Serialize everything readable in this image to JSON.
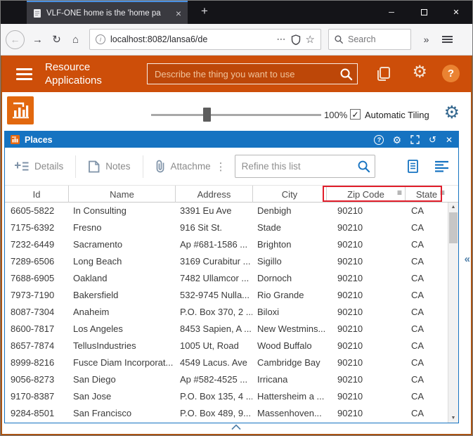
{
  "icons": {
    "minimize": "─",
    "close": "✕",
    "tab_close": "×",
    "new_tab": "+",
    "back": "←",
    "forward": "→",
    "reload": "↻",
    "home": "⌂",
    "info": "i",
    "page_actions": "⋯",
    "bookmark": "☆",
    "more_tools": "»",
    "overflow": "⋮",
    "filter": "≡",
    "gear": "⚙",
    "check": "✓",
    "help": "?",
    "history": "↺",
    "collapse": "«",
    "scroll_up": "▲",
    "scroll_down": "▼"
  },
  "browser": {
    "tab_title": "VLF-ONE home is the 'home pa",
    "url": "localhost:8082/lansa6/de",
    "search_placeholder": "Search"
  },
  "header": {
    "title_line1": "Resource",
    "title_line2": "Applications",
    "search_placeholder": "Describe the thing you want to use"
  },
  "workspace": {
    "zoom": "100%",
    "tiling_label": "Automatic Tiling",
    "checkbox_checked": true
  },
  "places": {
    "title": "Places",
    "toolbar": {
      "details": "Details",
      "notes": "Notes",
      "attachments": "Attachme",
      "refine_placeholder": "Refine this list"
    },
    "table": {
      "columns": [
        "Id",
        "Name",
        "Address",
        "City",
        "Zip Code",
        "State"
      ],
      "filter_columns": [
        4,
        5
      ],
      "rows": [
        [
          "6605-5822",
          "In Consulting",
          "3391 Eu Ave",
          "Denbigh",
          "90210",
          "CA"
        ],
        [
          "7175-6392",
          "Fresno",
          "916 Sit St.",
          "Stade",
          "90210",
          "CA"
        ],
        [
          "7232-6449",
          "Sacramento",
          "Ap #681-1586 ...",
          "Brighton",
          "90210",
          "CA"
        ],
        [
          "7289-6506",
          "Long Beach",
          "3169 Curabitur ...",
          "Sigillo",
          "90210",
          "CA"
        ],
        [
          "7688-6905",
          "Oakland",
          "7482 Ullamcor ...",
          "Dornoch",
          "90210",
          "CA"
        ],
        [
          "7973-7190",
          "Bakersfield",
          "532-9745 Nulla...",
          "Rio Grande",
          "90210",
          "CA"
        ],
        [
          "8087-7304",
          "Anaheim",
          "P.O. Box 370, 2 ...",
          "Biloxi",
          "90210",
          "CA"
        ],
        [
          "8600-7817",
          "Los Angeles",
          "8453 Sapien, A ...",
          "New Westmins...",
          "90210",
          "CA"
        ],
        [
          "8657-7874",
          "TellusIndustries",
          "1005 Ut, Road",
          "Wood Buffalo",
          "90210",
          "CA"
        ],
        [
          "8999-8216",
          "Fusce Diam Incorporat...",
          "4549 Lacus. Ave",
          "Cambridge Bay",
          "90210",
          "CA"
        ],
        [
          "9056-8273",
          "San Diego",
          "Ap #582-4525 ...",
          "Irricana",
          "90210",
          "CA"
        ],
        [
          "9170-8387",
          "San Jose",
          "P.O. Box 135, 4 ...",
          "Hattersheim a ...",
          "90210",
          "CA"
        ],
        [
          "9284-8501",
          "San Francisco",
          "P.O. Box 489, 9...",
          "Massenhoven...",
          "90210",
          "CA"
        ]
      ]
    }
  },
  "colors": {
    "accent_orange": "#cd4e09",
    "panel_blue": "#1673c1",
    "annotation_red": "#e11e2b"
  }
}
